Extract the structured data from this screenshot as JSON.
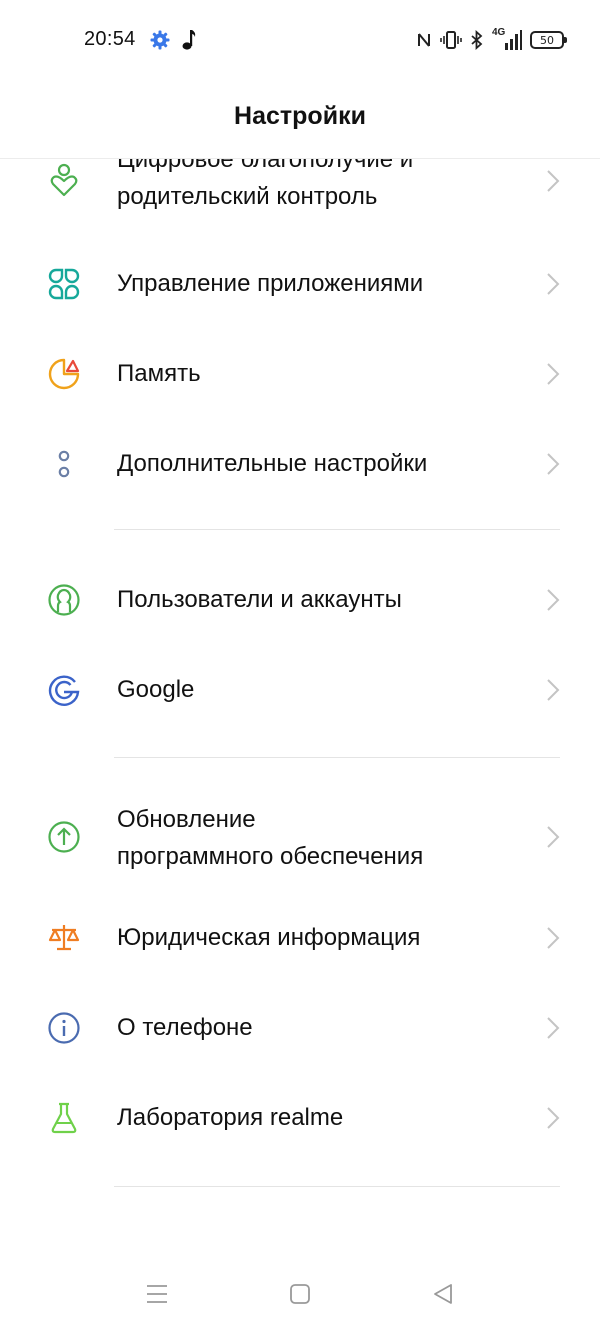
{
  "status_bar": {
    "time": "20:54",
    "network": "4G",
    "battery_level": "50",
    "icons": [
      "gear-icon",
      "music-note-icon",
      "nfc-icon",
      "vibrate-icon",
      "bluetooth-icon",
      "signal-icon",
      "battery-icon"
    ]
  },
  "header": {
    "title": "Настройки"
  },
  "items": [
    {
      "label_line1": "Цифровое благополучие и",
      "label_line2": "родительский контроль",
      "icon": "digital-wellbeing-icon",
      "color": "#4caf50"
    },
    {
      "label": "Управление приложениями",
      "icon": "app-management-icon",
      "color": "#16a89a"
    },
    {
      "label": "Память",
      "icon": "storage-icon",
      "color": "#f0a21b"
    },
    {
      "label": "Дополнительные настройки",
      "icon": "additional-settings-icon",
      "color": "#6b7fa6"
    },
    {
      "label": "Пользователи и аккаунты",
      "icon": "users-accounts-icon",
      "color": "#4caf50"
    },
    {
      "label": "Google",
      "icon": "google-icon",
      "color": "#3b63c9"
    },
    {
      "label_line1": "Обновление",
      "label_line2": "программного обеспечения",
      "icon": "software-update-icon",
      "color": "#4caf50"
    },
    {
      "label": "Юридическая информация",
      "icon": "legal-info-icon",
      "color": "#ef7d22"
    },
    {
      "label": "О телефоне",
      "icon": "about-phone-icon",
      "color": "#4a6bb0"
    },
    {
      "label": "Лаборатория realme",
      "icon": "realme-lab-icon",
      "color": "#6fd14a"
    }
  ],
  "nav": {
    "icons": [
      "recents-icon",
      "home-icon",
      "back-icon"
    ]
  }
}
